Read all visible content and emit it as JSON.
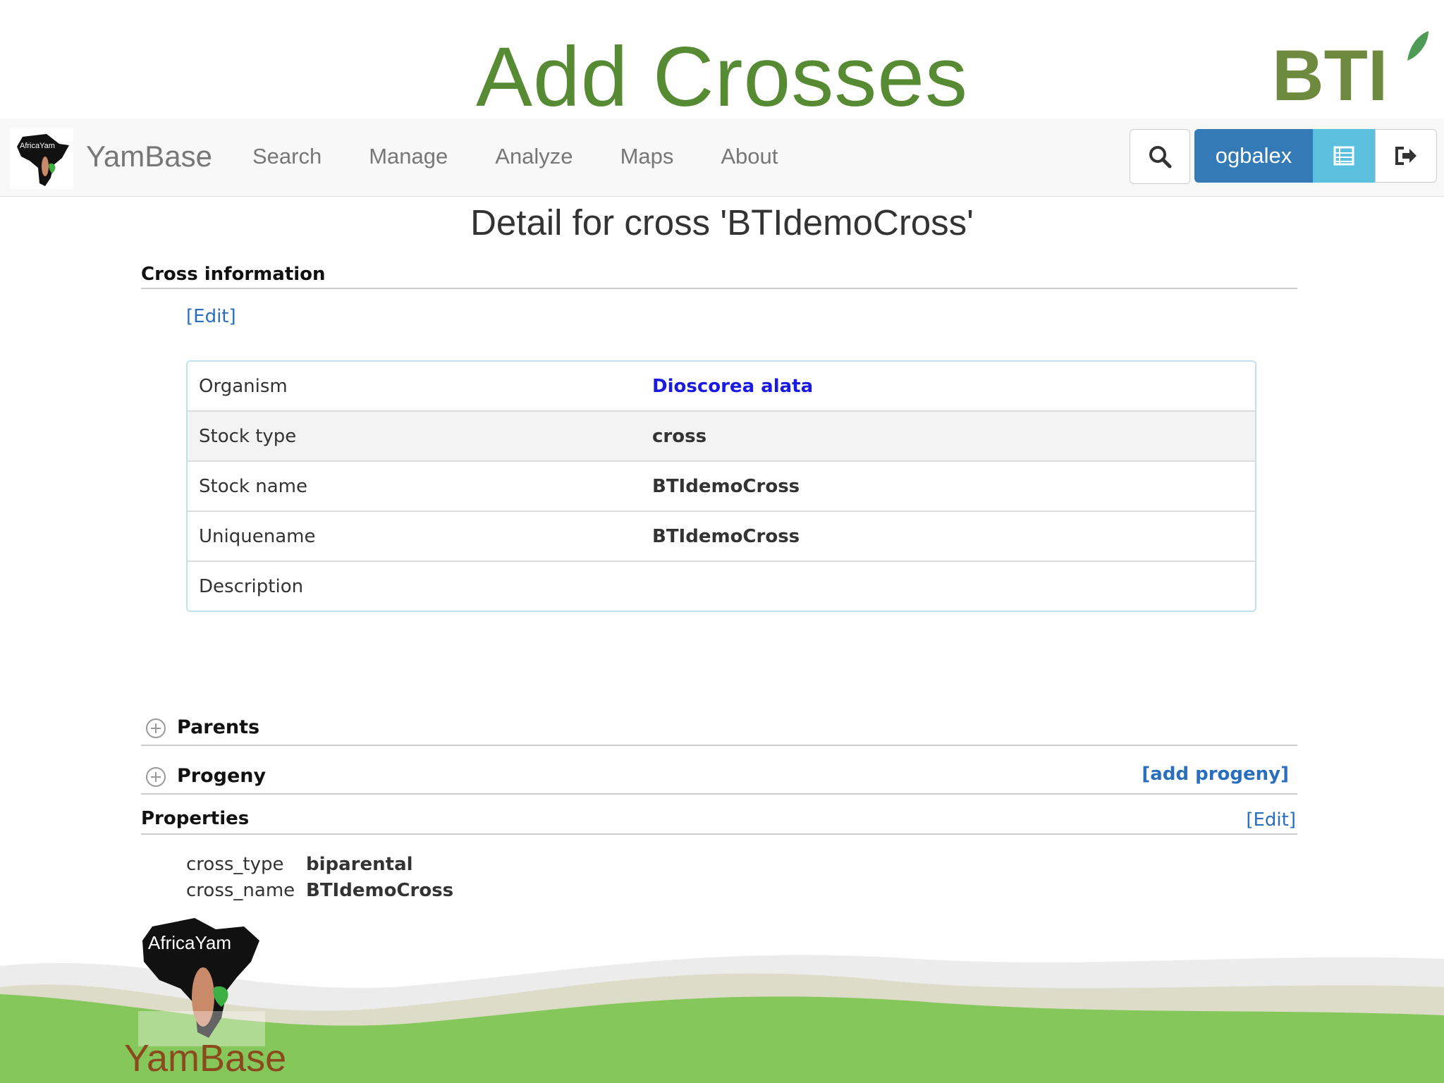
{
  "slide": {
    "title": "Add Crosses",
    "bti_logo_text": "BTI"
  },
  "navbar": {
    "logo_text": "AfricaYam",
    "brand": "YamBase",
    "menu": [
      "Search",
      "Manage",
      "Analyze",
      "Maps",
      "About"
    ],
    "username": "ogbalex"
  },
  "page": {
    "heading": "Detail for cross 'BTIdemoCross'"
  },
  "cross_info": {
    "title": "Cross information",
    "edit_link": "[Edit]",
    "rows": [
      {
        "key": "Organism",
        "value": "Dioscorea alata"
      },
      {
        "key": "Stock type",
        "value": "cross"
      },
      {
        "key": "Stock name",
        "value": "BTIdemoCross"
      },
      {
        "key": "Uniquename",
        "value": "BTIdemoCross"
      },
      {
        "key": "Description",
        "value": ""
      }
    ]
  },
  "parents": {
    "title": "Parents"
  },
  "progeny": {
    "title": "Progeny",
    "add_link": "[add progeny]"
  },
  "properties": {
    "title": "Properties",
    "edit_link": "[Edit]",
    "items": [
      {
        "key": "cross_type",
        "value": "biparental"
      },
      {
        "key": "cross_name",
        "value": "BTIdemoCross"
      }
    ]
  },
  "footer": {
    "logo_text": "AfricaYam",
    "caption": "YamBase"
  },
  "colors": {
    "title_green": "#568b34",
    "primary_button": "#337ab7",
    "info_button": "#5bc0de",
    "link_blue": "#2a6fbd",
    "organism_link": "#1a1ae0",
    "wave_green": "#85c75a",
    "caption_brown": "#8a4a1e"
  }
}
